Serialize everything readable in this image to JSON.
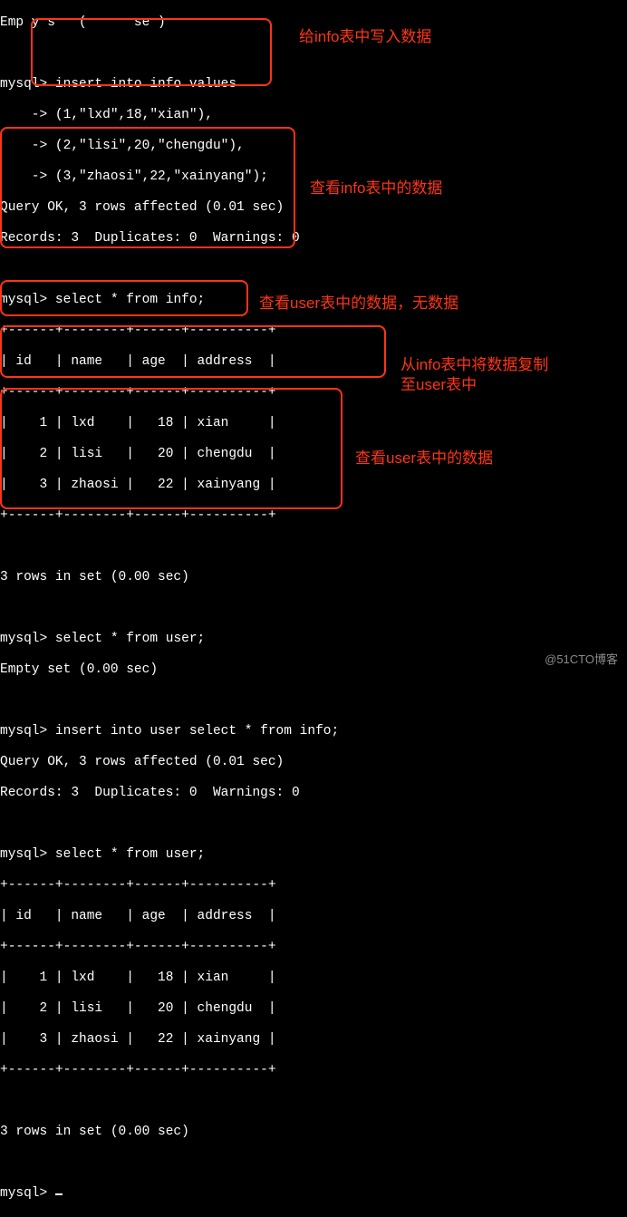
{
  "topCut": "Emp y s   (      se )",
  "prompt": "mysql>",
  "cont": "    ->",
  "insertInfo": {
    "l1": "insert into info values",
    "l2": "(1,\"lxd\",18,\"xian\"),",
    "l3": "(2,\"lisi\",20,\"chengdu\"),",
    "l4": "(3,\"zhaosi\",22,\"xainyang\");"
  },
  "insertInfoResult": {
    "l1": "Query OK, 3 rows affected (0.01 sec)",
    "l2": "Records: 3  Duplicates: 0  Warnings: 0"
  },
  "selectInfo": {
    "cmd": "select * from info;"
  },
  "table": {
    "border": "+------+--------+------+----------+",
    "header": "| id   | name   | age  | address  |",
    "r1": "|    1 | lxd    |   18 | xian     |",
    "r2": "|    2 | lisi   |   20 | chengdu  |",
    "r3": "|    3 | zhaosi |   22 | xainyang |"
  },
  "rowsMsg": "3 rows in set (0.00 sec)",
  "selectUser": {
    "cmd": "select * from user;",
    "empty": "Empty set (0.00 sec)"
  },
  "insertUser": {
    "cmd": "insert into user select * from info;",
    "r1": "Query OK, 3 rows affected (0.01 sec)",
    "r2": "Records: 3  Duplicates: 0  Warnings: 0"
  },
  "selectUser2": {
    "cmd": "select * from user;"
  },
  "annots": {
    "a1": "给info表中写入数据",
    "a2": "查看info表中的数据",
    "a3": "查看user表中的数据，无数据",
    "a4_l1": "从info表中将数据复制",
    "a4_l2": "至user表中",
    "a5": "查看user表中的数据"
  },
  "watermark": "@51CTO博客"
}
